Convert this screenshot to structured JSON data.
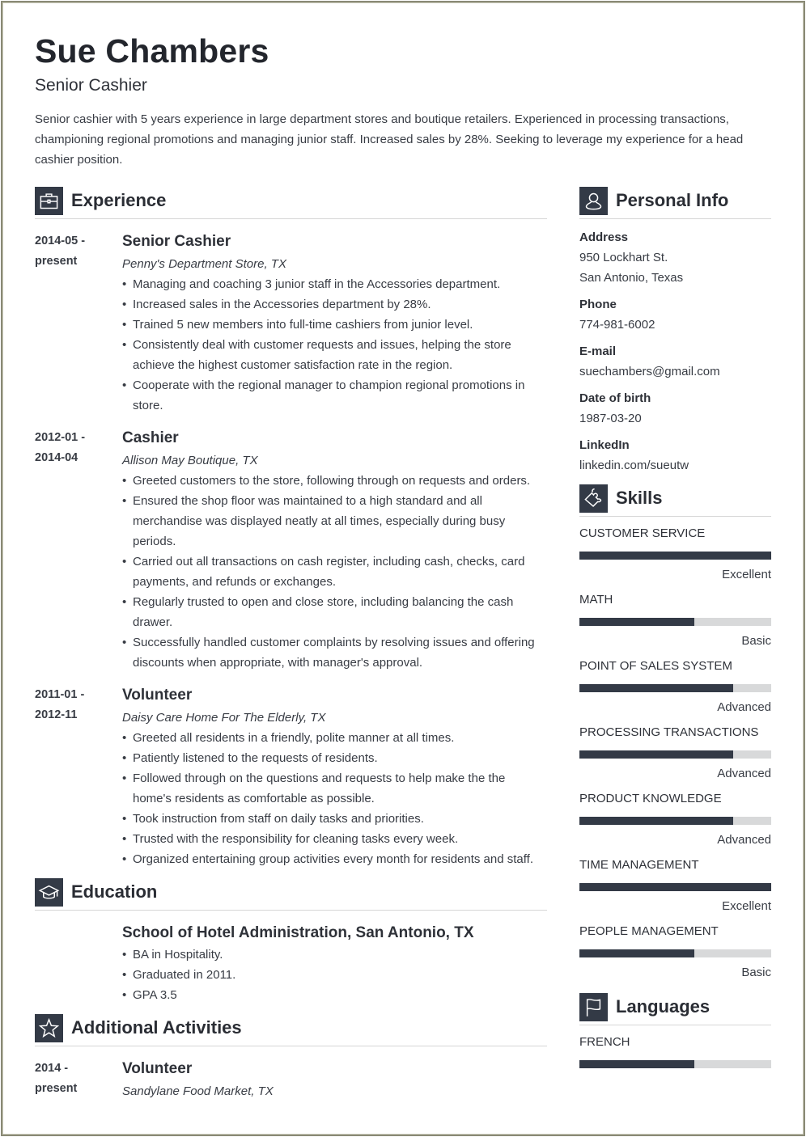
{
  "header": {
    "name": "Sue Chambers",
    "title": "Senior Cashier",
    "summary": "Senior cashier with 5 years experience in large department stores and boutique retailers. Experienced in processing transactions, championing regional promotions and managing junior staff. Increased sales by 28%. Seeking to leverage my experience for a head cashier position."
  },
  "experience": {
    "heading": "Experience",
    "icon": "briefcase-icon",
    "entries": [
      {
        "date_start": "2014-05 -",
        "date_end": "present",
        "role": "Senior Cashier",
        "org": "Penny's Department Store, TX",
        "bullets": [
          "Managing and coaching 3 junior staff in the Accessories department.",
          "Increased sales in the Accessories department by 28%.",
          "Trained 5 new members into full-time cashiers from junior level.",
          "Consistently deal with customer requests and issues, helping the store achieve the highest customer satisfaction rate in the region.",
          "Cooperate with the regional manager to champion regional promotions in store."
        ]
      },
      {
        "date_start": "2012-01 -",
        "date_end": "2014-04",
        "role": "Cashier",
        "org": "Allison May Boutique, TX",
        "bullets": [
          "Greeted customers to the store, following through on requests and orders.",
          "Ensured the shop floor was maintained to a high standard and all merchandise was displayed neatly at all times, especially during busy periods.",
          "Carried out all transactions on cash register, including cash, checks, card payments, and refunds or exchanges.",
          "Regularly trusted to open and close store, including balancing the cash drawer.",
          "Successfully handled customer complaints by resolving issues and offering discounts when appropriate, with manager's approval."
        ]
      },
      {
        "date_start": "2011-01 -",
        "date_end": "2012-11",
        "role": "Volunteer",
        "org": "Daisy Care Home For The Elderly, TX",
        "bullets": [
          "Greeted all residents in a friendly, polite manner at all times.",
          "Patiently listened to the requests of residents.",
          "Followed through on the questions and requests to help make the the home's residents as comfortable as possible.",
          "Took instruction from staff on daily tasks and priorities.",
          "Trusted with the responsibility for cleaning tasks every week.",
          "Organized entertaining group activities every month for residents and staff."
        ]
      }
    ]
  },
  "education": {
    "heading": "Education",
    "icon": "graduation-cap-icon",
    "school": "School of Hotel Administration, San Antonio, TX",
    "bullets": [
      "BA in Hospitality.",
      "Graduated in 2011.",
      "GPA 3.5"
    ]
  },
  "activities": {
    "heading": "Additional Activities",
    "icon": "star-icon",
    "entries": [
      {
        "date_start": "2014 -",
        "date_end": "present",
        "role": "Volunteer",
        "org": "Sandylane Food Market, TX"
      }
    ]
  },
  "personal_info": {
    "heading": "Personal Info",
    "icon": "user-icon",
    "address_label": "Address",
    "address_line1": "950 Lockhart St.",
    "address_line2": "San Antonio, Texas",
    "phone_label": "Phone",
    "phone": "774-981-6002",
    "email_label": "E-mail",
    "email": "suechambers@gmail.com",
    "dob_label": "Date of birth",
    "dob": "1987-03-20",
    "linkedin_label": "LinkedIn",
    "linkedin": "linkedin.com/sueutw"
  },
  "skills": {
    "heading": "Skills",
    "icon": "puzzle-icon",
    "items": [
      {
        "name": "CUSTOMER SERVICE",
        "level": "Excellent",
        "fraction": 1.0
      },
      {
        "name": "MATH",
        "level": "Basic",
        "fraction": 0.6
      },
      {
        "name": "POINT OF SALES SYSTEM",
        "level": "Advanced",
        "fraction": 0.8
      },
      {
        "name": "PROCESSING TRANSACTIONS",
        "level": "Advanced",
        "fraction": 0.8
      },
      {
        "name": "PRODUCT KNOWLEDGE",
        "level": "Advanced",
        "fraction": 0.8
      },
      {
        "name": "TIME MANAGEMENT",
        "level": "Excellent",
        "fraction": 1.0
      },
      {
        "name": "PEOPLE MANAGEMENT",
        "level": "Basic",
        "fraction": 0.6
      }
    ]
  },
  "languages": {
    "heading": "Languages",
    "icon": "flag-icon",
    "items": [
      {
        "name": "FRENCH",
        "fraction": 0.6
      }
    ]
  },
  "colors": {
    "accent": "#333a46",
    "bar_track": "#d8d9da",
    "text": "#383c44",
    "border": "#8a8a76"
  }
}
